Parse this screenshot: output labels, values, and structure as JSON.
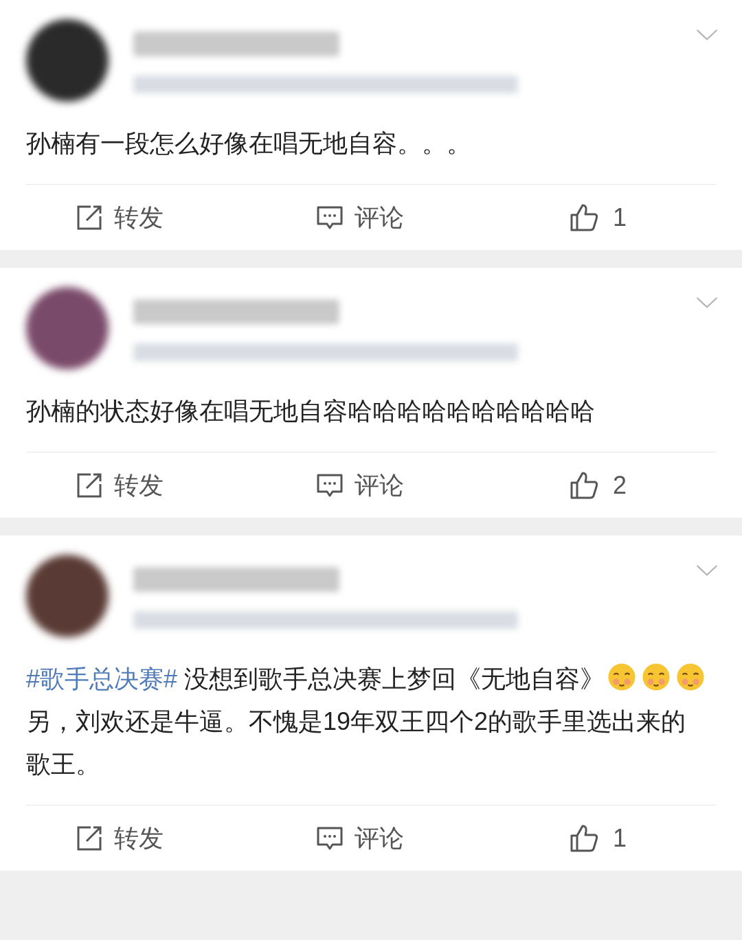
{
  "posts": [
    {
      "avatar": {
        "color": "#2a2a2a"
      },
      "content": [
        {
          "kind": "text",
          "text": "孙楠有一段怎么好像在唱无地自容。。。"
        }
      ],
      "actions": {
        "repost": "转发",
        "comment": "评论",
        "likes": "1"
      }
    },
    {
      "avatar": {
        "color": "#7a4a6a"
      },
      "content": [
        {
          "kind": "text",
          "text": "孙楠的状态好像在唱无地自容哈哈哈哈哈哈哈哈哈哈"
        }
      ],
      "actions": {
        "repost": "转发",
        "comment": "评论",
        "likes": "2"
      }
    },
    {
      "avatar": {
        "color": "#5a3a34"
      },
      "content": [
        {
          "kind": "hashtag",
          "text": "#歌手总决赛#"
        },
        {
          "kind": "text",
          "text": " 没想到歌手总决赛上梦回《无地自容》"
        },
        {
          "kind": "emoji"
        },
        {
          "kind": "emoji"
        },
        {
          "kind": "emoji"
        },
        {
          "kind": "text",
          "text": " 另，刘欢还是牛逼。不愧是19年双王四个2的歌手里选出来的歌王。"
        }
      ],
      "actions": {
        "repost": "转发",
        "comment": "评论",
        "likes": "1"
      }
    }
  ]
}
